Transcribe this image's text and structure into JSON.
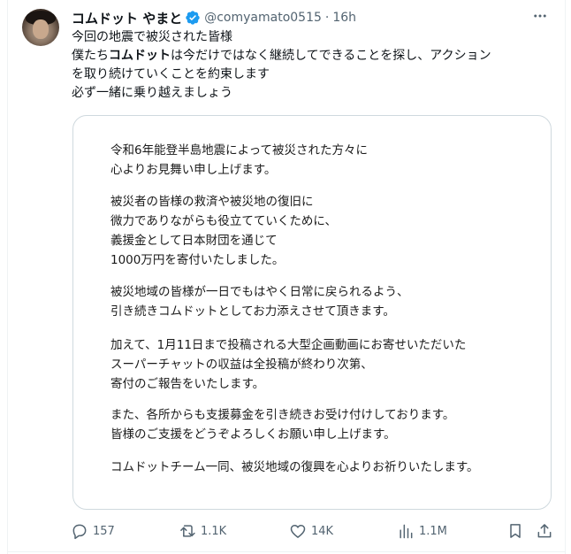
{
  "tweet": {
    "author": {
      "display_name": "コムドット やまと",
      "handle": "@comyamato0515",
      "separator": "·",
      "time": "16h",
      "verified": true,
      "avatar_icon": "profile-photo"
    },
    "text": {
      "line1": "今回の地震で被災された皆様",
      "line2_a": "僕たち",
      "line2_bold": "コムドット",
      "line2_b": "は今だけではなく継続してできることを探し、アクション",
      "line3": "を取り続けていくことを約束します",
      "line4": "必ず一緒に乗り越えましょう"
    },
    "image_card": {
      "p1": [
        "令和6年能登半島地震によって被災された方々に",
        "心よりお見舞い申し上げます。"
      ],
      "p2": [
        "被災者の皆様の救済や被災地の復旧に",
        "微力でありながらも役立てていくために、",
        "義援金として日本財団を通じて",
        "1000万円を寄付いたしました。"
      ],
      "p3": [
        "被災地域の皆様が一日でもはやく日常に戻られるよう、",
        "引き続きコムドットとしてお力添えさせて頂きます。"
      ],
      "p4": [
        "加えて、1月11日まで投稿される大型企画動画にお寄せいただいた",
        "スーパーチャットの収益は全投稿が終わり次第、",
        "寄付のご報告をいたします。"
      ],
      "p5": [
        "また、各所からも支援募金を引き続きお受け付けしております。",
        "皆様のご支援をどうぞよろしくお願い申し上げます。"
      ],
      "p6": [
        "コムドットチーム一同、被災地域の復興を心よりお祈りいたします。"
      ]
    },
    "actions": {
      "replies": "157",
      "reposts": "1.1K",
      "likes": "14K",
      "views": "1.1M"
    }
  },
  "colors": {
    "text": "#0f1419",
    "secondary": "#536471",
    "verified": "#1d9bf0",
    "border": "#cfd9de"
  }
}
